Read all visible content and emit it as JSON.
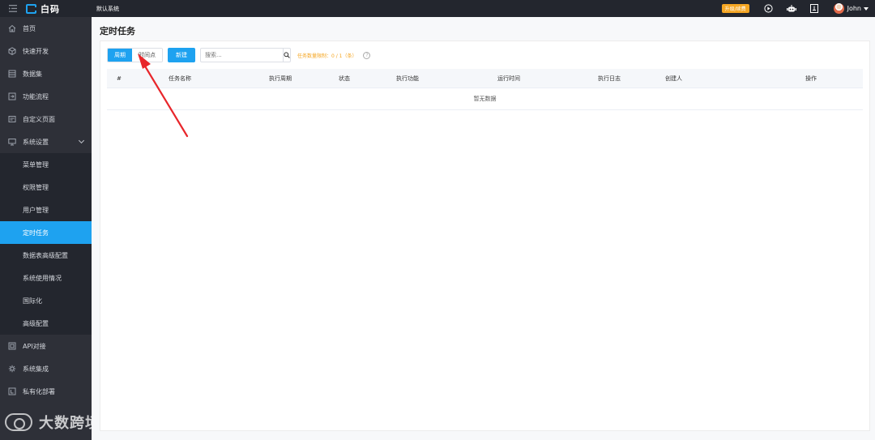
{
  "topbar": {
    "logo_text": "白码",
    "system_name": "默认系统",
    "upgrade_badge": "升级/续费",
    "username": "John",
    "icons": [
      "menu-toggle-icon",
      "play-circle-icon",
      "robot-icon",
      "document-icon",
      "user-avatar"
    ]
  },
  "sidebar": {
    "items": [
      {
        "label": "首页",
        "icon": "home-icon"
      },
      {
        "label": "快速开发",
        "icon": "cube-icon"
      },
      {
        "label": "数据集",
        "icon": "database-icon"
      },
      {
        "label": "功能流程",
        "icon": "flow-icon"
      },
      {
        "label": "自定义页面",
        "icon": "page-icon"
      },
      {
        "label": "系统设置",
        "icon": "monitor-icon"
      }
    ],
    "submenu": [
      {
        "label": "菜单管理"
      },
      {
        "label": "权限管理"
      },
      {
        "label": "用户管理"
      },
      {
        "label": "定时任务"
      },
      {
        "label": "数据表高级配置"
      },
      {
        "label": "系统使用情况"
      },
      {
        "label": "国际化"
      },
      {
        "label": "高级配置"
      }
    ],
    "items_after": [
      {
        "label": "API对接",
        "icon": "api-icon"
      },
      {
        "label": "系统集成",
        "icon": "integration-icon"
      },
      {
        "label": "私有化部署",
        "icon": "deploy-icon"
      }
    ],
    "watermark": "大数跨境"
  },
  "main": {
    "title": "定时任务",
    "toolbar": {
      "tab_period": "周期",
      "tab_timepoint": "时间点",
      "new_button": "新建",
      "search_placeholder": "搜索...",
      "limit_text": "任务数量限制：0 / 1（条）",
      "help": "?"
    },
    "table": {
      "columns": [
        "#",
        "任务名称",
        "执行周期",
        "状态",
        "执行功能",
        "运行时间",
        "执行日志",
        "创建人",
        "操作"
      ],
      "empty_text": "暂无数据"
    }
  },
  "colors": {
    "accent": "#1ea2f0",
    "warning": "#f5a623",
    "annotation_arrow": "#e8262b",
    "sidebar_bg": "#2e3038",
    "topbar_bg": "#23262e"
  }
}
